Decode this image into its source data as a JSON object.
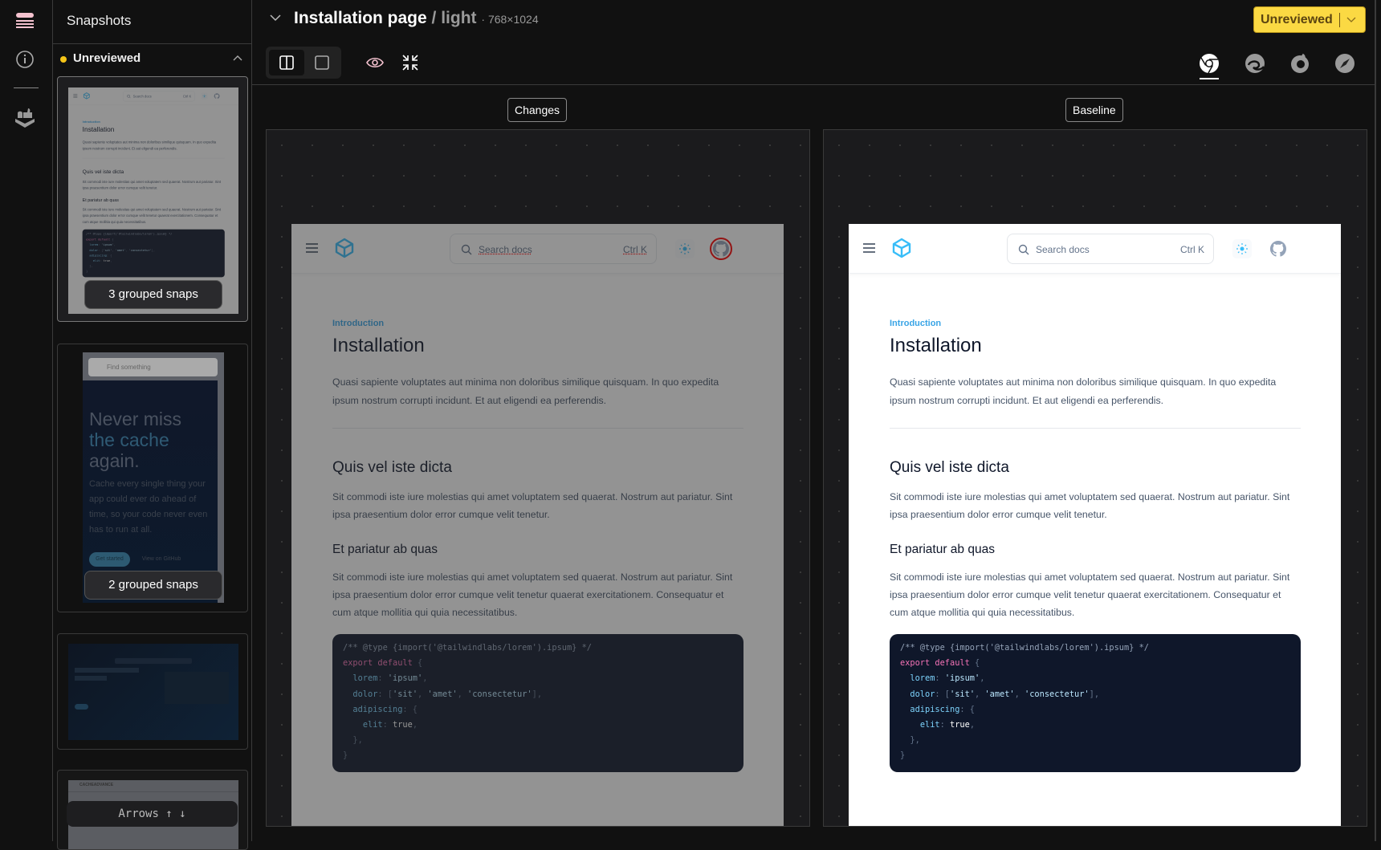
{
  "sidebar": {
    "title": "Snapshots",
    "group_label": "Unreviewed",
    "cards": [
      {
        "badge": "3 grouped snaps"
      },
      {
        "badge": "2 grouped snaps",
        "search_placeholder": "Find something",
        "hero_line1": "Never miss",
        "hero_line2": "the cache",
        "hero_line3": "again.",
        "hero_text": "Cache every single thing your app could ever do ahead of time, so your code never even has to run at all.",
        "cta_primary": "Get started",
        "cta_secondary": "View on GitHub"
      },
      {},
      {
        "brand": "CACHEADVANCE"
      }
    ],
    "keyboard_hint": "Arrows ↑ ↓"
  },
  "header": {
    "title": "Installation page",
    "variant": "/ light",
    "size": "· 768×1024",
    "review_status": "Unreviewed"
  },
  "toolbar": {
    "browsers": [
      "chrome",
      "edge",
      "firefox",
      "safari"
    ],
    "active_browser": "chrome"
  },
  "panels": {
    "changes_label": "Changes",
    "baseline_label": "Baseline"
  },
  "page": {
    "search_placeholder": "Search docs",
    "search_shortcut": "Ctrl K",
    "eyebrow": "Introduction",
    "title": "Installation",
    "intro": "Quasi sapiente voluptates aut minima non doloribus similique quisquam. In quo expedita ipsum nostrum corrupti incidunt. Et aut eligendi ea perferendis.",
    "h2": "Quis vel iste dicta",
    "p2": "Sit commodi iste iure molestias qui amet voluptatem sed quaerat. Nostrum aut pariatur. Sint ipsa praesentium dolor error cumque velit tenetur.",
    "h3": "Et pariatur ab quas",
    "p3": "Sit commodi iste iure molestias qui amet voluptatem sed quaerat. Nostrum aut pariatur. Sint ipsa praesentium dolor error cumque velit tenetur quaerat exercitationem. Consequatur et cum atque mollitia qui quia necessitatibus.",
    "code": {
      "l1": "/** @type {import('@tailwindlabs/lorem').ipsum} */",
      "l2a": "export default",
      "l3k": "lorem",
      "l3v": "'ipsum'",
      "l4k": "dolor",
      "l4v1": "'sit'",
      "l4v2": "'amet'",
      "l4v3": "'consectetur'",
      "l5k": "adipiscing",
      "l6k": "elit",
      "l6v": "true"
    }
  },
  "colors": {
    "accent": "#fbd943",
    "unreviewed_dot": "#f5c518",
    "diff": "#ff0000",
    "brand": "#38bdf8"
  }
}
